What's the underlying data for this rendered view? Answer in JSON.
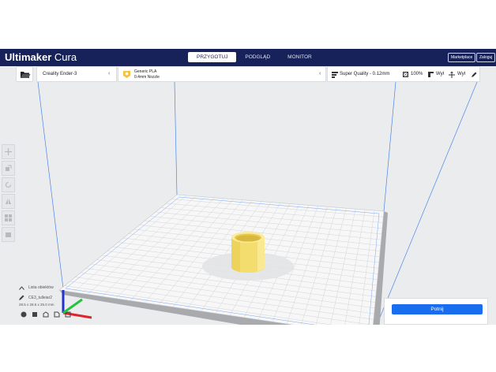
{
  "header": {
    "logo_brand": "Ultimaker",
    "logo_product": "Cura",
    "stages": [
      "PRZYGOTUJ",
      "PODGLĄD",
      "MONITOR"
    ],
    "marketplace_label": "Marketplace",
    "login_label": "Zaloguj"
  },
  "toolbar": {
    "printer_name": "Creality Ender-3",
    "material_name": "Generic PLA",
    "nozzle_name": "0.4mm Nozzle",
    "quality": "Super Quality - 0.12mm",
    "infill": "100%",
    "support": "Wył",
    "adhesion": "Wył"
  },
  "object": {
    "list_label": "Lista obiektów",
    "name": "CE3_tulleiar2",
    "dimensions": "28.5 x 28.5 x 25.0 mm"
  },
  "action": {
    "slice_label": "Potnij"
  },
  "colors": {
    "header": "#17215a",
    "slice_button": "#196ef0",
    "model": "#f6e27c"
  }
}
